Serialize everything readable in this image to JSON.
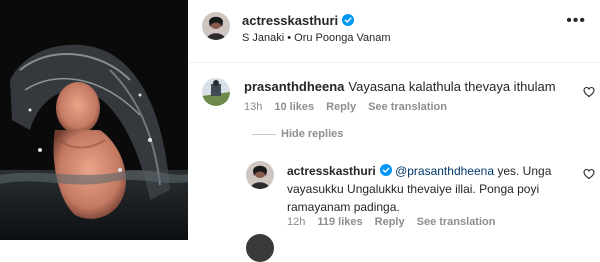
{
  "header": {
    "username": "actresskasthuri",
    "subtitle": "S Janaki • Oru Poonga Vanam",
    "more_label": "•••"
  },
  "comment1": {
    "username": "prasanthdheena",
    "text": "Vayasana kalathula thevaya ithulam",
    "time": "13h",
    "likes": "10 likes",
    "reply_label": "Reply",
    "translate_label": "See translation"
  },
  "hide_replies_label": "Hide replies",
  "reply": {
    "username": "actresskasthuri",
    "mention": "@prasanthdheena",
    "text": " yes. Unga vayasukku Ungalukku thevaiye illai. Ponga poyi ramayanam padinga.",
    "time": "12h",
    "likes": "119 likes",
    "reply_label": "Reply",
    "translate_label": "See translation"
  },
  "icons": {
    "verified": "verified-badge-icon",
    "heart": "heart-icon",
    "more": "more-icon"
  },
  "colors": {
    "verified_blue": "#0095f6",
    "meta_gray": "#8e8e8e",
    "mention_blue": "#00376b"
  }
}
